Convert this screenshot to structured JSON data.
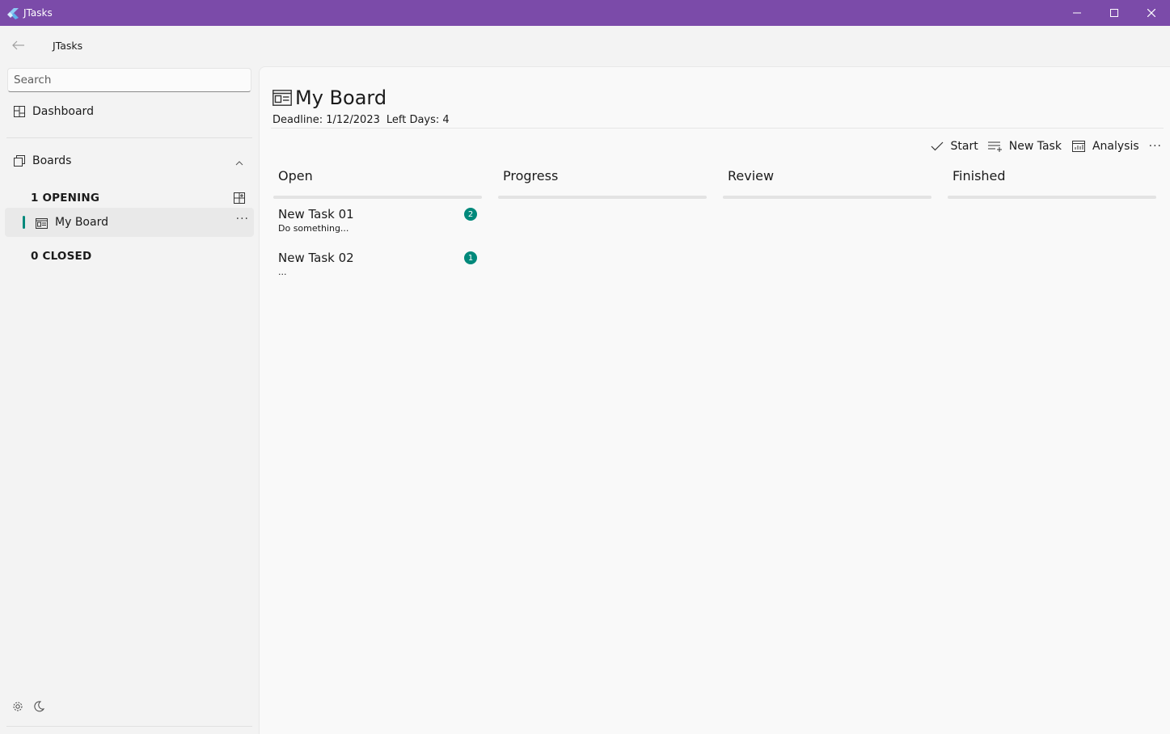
{
  "window": {
    "title": "JTasks",
    "accent_color": "#7b4ba9",
    "controls": [
      "minimize-icon",
      "maximize-icon",
      "close-icon"
    ]
  },
  "nav": {
    "app_title": "JTasks",
    "search_placeholder": "Search",
    "dashboard_label": "Dashboard",
    "boards_label": "Boards",
    "opening_header": "1 OPENING",
    "closed_header": "0 CLOSED",
    "boards": [
      {
        "label": "My Board",
        "selected": true,
        "more": "···"
      }
    ]
  },
  "board": {
    "title": "My Board",
    "deadline": "Deadline: 1/12/2023",
    "left_days": "Left Days: 4",
    "toolbar": {
      "start_label": "Start",
      "new_task_label": "New Task",
      "analysis_label": "Analysis",
      "more_label": "···"
    },
    "columns": [
      {
        "title": "Open",
        "tasks": [
          {
            "name": "New Task 01",
            "description": "Do something...",
            "badge": "2"
          },
          {
            "name": "New Task 02",
            "description": "...",
            "badge": "1"
          }
        ]
      },
      {
        "title": "Progress",
        "tasks": []
      },
      {
        "title": "Review",
        "tasks": []
      },
      {
        "title": "Finished",
        "tasks": []
      }
    ],
    "badge_color": "#00897b"
  }
}
